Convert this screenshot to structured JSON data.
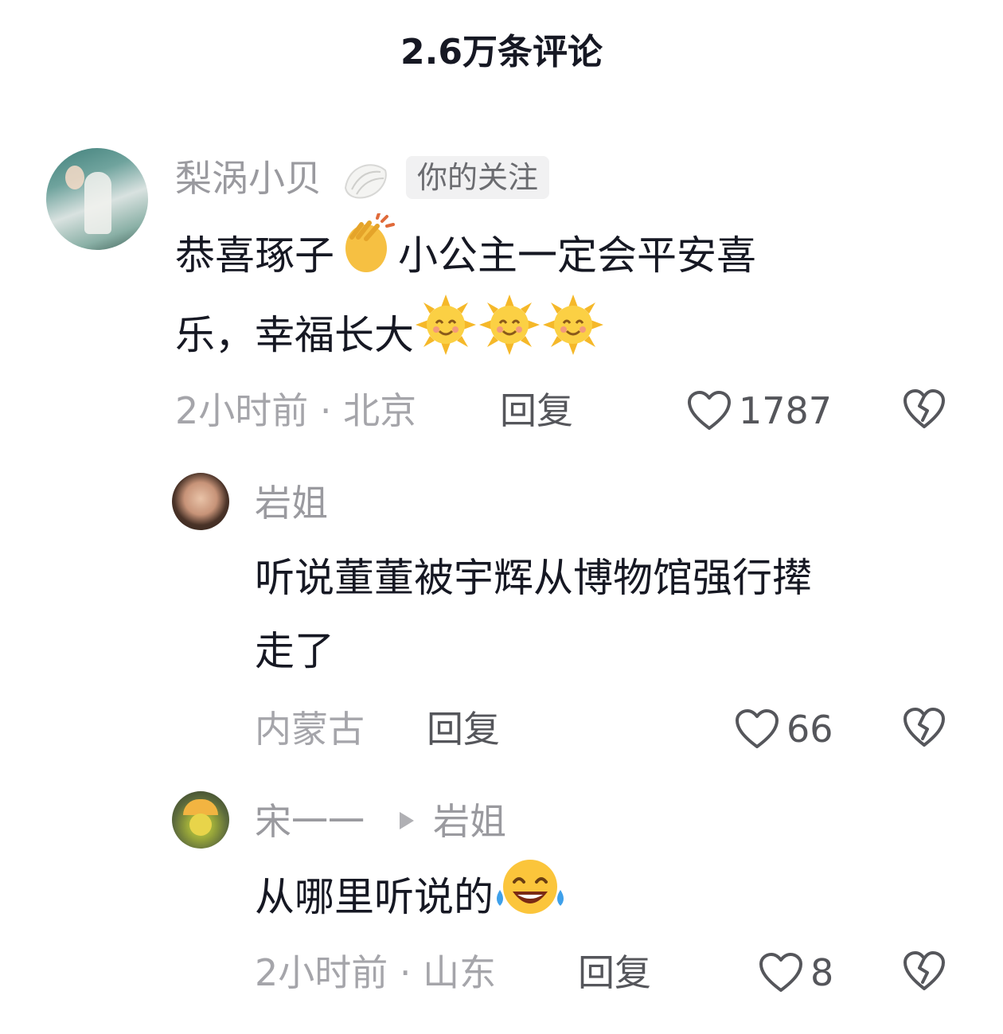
{
  "header": {
    "title": "2.6万条评论"
  },
  "comments": [
    {
      "author": "梨涡小贝",
      "author_badge_icon": "shell-icon",
      "follow_tag": "你的关注",
      "text_line1": "恭喜琢子",
      "text_line1_emoji": "clapping-hands-emoji",
      "text_line1_cont": "小公主一定会平安喜",
      "text_line2": "乐，幸福长大",
      "text_line2_emoji": "smiling-sun-emoji x3",
      "meta": "2小时前 · 北京",
      "reply_label": "回复",
      "likes": "1787"
    },
    {
      "author": "岩姐",
      "text_line1": "听说董董被宇辉从博物馆强行撵",
      "text_line2": "走了",
      "meta": "内蒙古",
      "reply_label": "回复",
      "likes": "66"
    },
    {
      "author": "宋一一",
      "reply_to": "岩姐",
      "text_line1": "从哪里听说的",
      "text_line1_emoji": "tears-of-joy-emoji",
      "meta": "2小时前 · 山东",
      "reply_label": "回复",
      "likes": "8"
    }
  ],
  "colors": {
    "text": "#161823",
    "muted": "#a5a5aa",
    "action": "#55565b"
  }
}
